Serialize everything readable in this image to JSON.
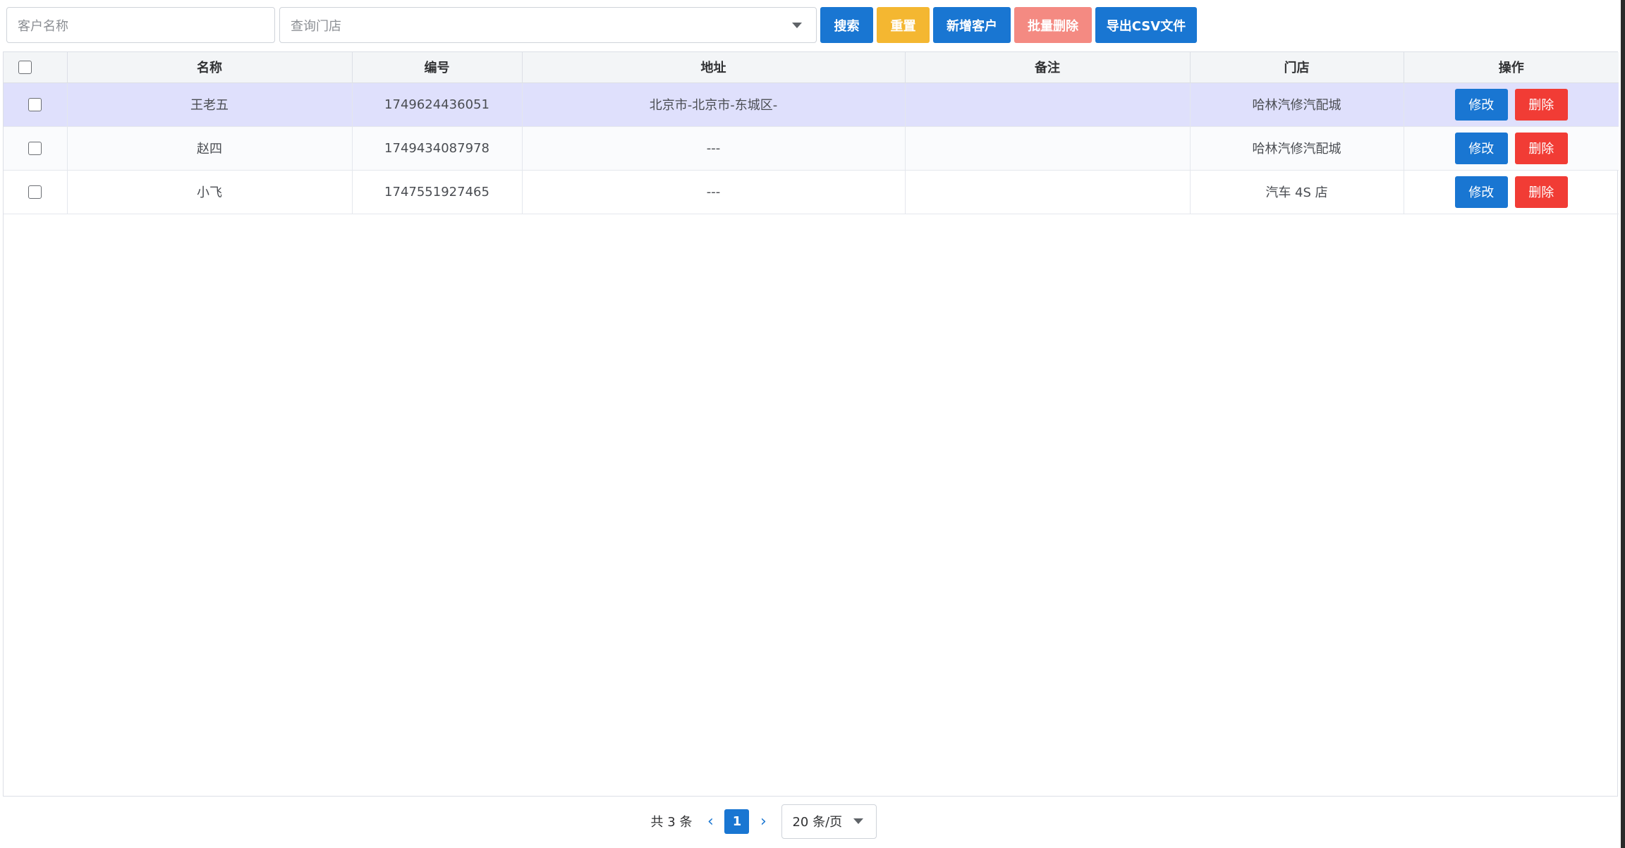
{
  "toolbar": {
    "customer_name_placeholder": "客户名称",
    "store_placeholder": "查询门店",
    "search_label": "搜索",
    "reset_label": "重置",
    "add_label": "新增客户",
    "batch_delete_label": "批量删除",
    "export_label": "导出CSV文件"
  },
  "table": {
    "columns": [
      "名称",
      "编号",
      "地址",
      "备注",
      "门店",
      "操作"
    ],
    "rows": [
      {
        "name": "王老五",
        "code": "1749624436051",
        "address": "北京市-北京市-东城区-",
        "remark": "",
        "store": "哈林汽修汽配城"
      },
      {
        "name": "赵四",
        "code": "1749434087978",
        "address": "---",
        "remark": "",
        "store": "哈林汽修汽配城"
      },
      {
        "name": "小飞",
        "code": "1747551927465",
        "address": "---",
        "remark": "",
        "store": "汽车 4S 店"
      }
    ],
    "edit_label": "修改",
    "delete_label": "删除"
  },
  "pagination": {
    "total": "共 3 条",
    "current_page": "1",
    "page_size": "20 条/页"
  },
  "colors": {
    "primary": "#1976d2",
    "warning": "#f4b731",
    "danger": "#f13c35",
    "danger_light": "#f48a82",
    "row_highlight": "#dfe0fc"
  }
}
